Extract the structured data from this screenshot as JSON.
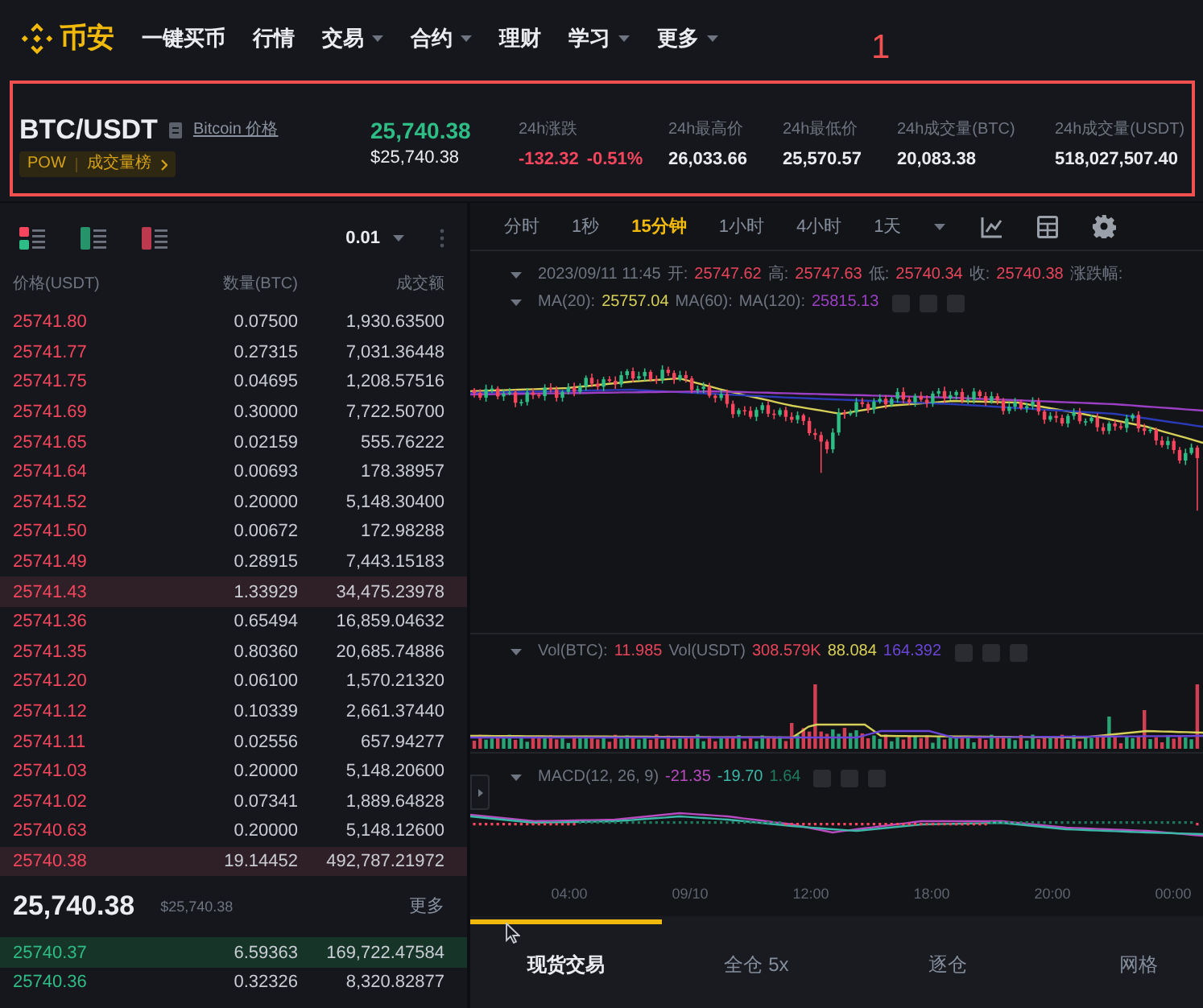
{
  "nav": {
    "logo": "币安",
    "items": [
      {
        "label": "一键买币",
        "has_menu": false
      },
      {
        "label": "行情",
        "has_menu": false
      },
      {
        "label": "交易",
        "has_menu": true
      },
      {
        "label": "合约",
        "has_menu": true
      },
      {
        "label": "理财",
        "has_menu": false
      },
      {
        "label": "学习",
        "has_menu": true
      },
      {
        "label": "更多",
        "has_menu": true
      }
    ]
  },
  "annotation": {
    "label": "1"
  },
  "ticker": {
    "symbol": "BTC/USDT",
    "info_link": "Bitcoin 价格",
    "tags": [
      "POW",
      "成交量榜"
    ],
    "price": "25,740.38",
    "price_usd": "$25,740.38",
    "stats": [
      {
        "label": "24h涨跌",
        "kind": "change",
        "values": [
          "-132.32",
          "-0.51%"
        ]
      },
      {
        "label": "24h最高价",
        "kind": "plain",
        "values": [
          "26,033.66"
        ]
      },
      {
        "label": "24h最低价",
        "kind": "plain",
        "values": [
          "25,570.57"
        ]
      },
      {
        "label": "24h成交量(BTC)",
        "kind": "plain",
        "values": [
          "20,083.38"
        ]
      },
      {
        "label": "24h成交量(USDT)",
        "kind": "plain",
        "values": [
          "518,027,507.40"
        ]
      }
    ]
  },
  "orderbook": {
    "precision": "0.01",
    "columns": [
      "价格(USDT)",
      "数量(BTC)",
      "成交额"
    ],
    "asks": [
      {
        "price": "25741.80",
        "amount": "0.07500",
        "total": "1,930.63500",
        "highlighted": false
      },
      {
        "price": "25741.77",
        "amount": "0.27315",
        "total": "7,031.36448",
        "highlighted": false
      },
      {
        "price": "25741.75",
        "amount": "0.04695",
        "total": "1,208.57516",
        "highlighted": false
      },
      {
        "price": "25741.69",
        "amount": "0.30000",
        "total": "7,722.50700",
        "highlighted": false
      },
      {
        "price": "25741.65",
        "amount": "0.02159",
        "total": "555.76222",
        "highlighted": false
      },
      {
        "price": "25741.64",
        "amount": "0.00693",
        "total": "178.38957",
        "highlighted": false
      },
      {
        "price": "25741.52",
        "amount": "0.20000",
        "total": "5,148.30400",
        "highlighted": false
      },
      {
        "price": "25741.50",
        "amount": "0.00672",
        "total": "172.98288",
        "highlighted": false
      },
      {
        "price": "25741.49",
        "amount": "0.28915",
        "total": "7,443.15183",
        "highlighted": false
      },
      {
        "price": "25741.43",
        "amount": "1.33929",
        "total": "34,475.23978",
        "highlighted": true
      },
      {
        "price": "25741.36",
        "amount": "0.65494",
        "total": "16,859.04632",
        "highlighted": false
      },
      {
        "price": "25741.35",
        "amount": "0.80360",
        "total": "20,685.74886",
        "highlighted": false
      },
      {
        "price": "25741.20",
        "amount": "0.06100",
        "total": "1,570.21320",
        "highlighted": false
      },
      {
        "price": "25741.12",
        "amount": "0.10339",
        "total": "2,661.37440",
        "highlighted": false
      },
      {
        "price": "25741.11",
        "amount": "0.02556",
        "total": "657.94277",
        "highlighted": false
      },
      {
        "price": "25741.03",
        "amount": "0.20000",
        "total": "5,148.20600",
        "highlighted": false
      },
      {
        "price": "25741.02",
        "amount": "0.07341",
        "total": "1,889.64828",
        "highlighted": false
      },
      {
        "price": "25740.63",
        "amount": "0.20000",
        "total": "5,148.12600",
        "highlighted": false
      },
      {
        "price": "25740.38",
        "amount": "19.14452",
        "total": "492,787.21972",
        "highlighted": true
      }
    ],
    "last_price": "25,740.38",
    "last_price_usd": "$25,740.38",
    "more": "更多",
    "bids": [
      {
        "price": "25740.37",
        "amount": "6.59363",
        "total": "169,722.47584",
        "highlighted": true
      },
      {
        "price": "25740.36",
        "amount": "0.32326",
        "total": "8,320.82877",
        "highlighted": false
      }
    ]
  },
  "chart": {
    "intervals": [
      {
        "label": "分时",
        "selected": false
      },
      {
        "label": "1秒",
        "selected": false
      },
      {
        "label": "15分钟",
        "selected": true
      },
      {
        "label": "1小时",
        "selected": false
      },
      {
        "label": "4小时",
        "selected": false
      },
      {
        "label": "1天",
        "selected": false
      }
    ],
    "ohlc": {
      "time": "2023/09/11 11:45",
      "fields": [
        {
          "label": "开:",
          "value": "25747.62"
        },
        {
          "label": "高:",
          "value": "25747.63"
        },
        {
          "label": "低:",
          "value": "25740.34"
        },
        {
          "label": "收:",
          "value": "25740.38"
        },
        {
          "label": "涨跌幅:"
        }
      ]
    },
    "ma": [
      {
        "label": "MA(20):",
        "value": "25757.04",
        "color": "#d6cf58"
      },
      {
        "label": "MA(60):",
        "color": "#2b3bb8"
      },
      {
        "label": "MA(120):",
        "value": "25815.13",
        "color": "#9b3fc4"
      }
    ],
    "volume": {
      "fields": [
        {
          "label": "Vol(BTC):",
          "value": "11.985",
          "color": "#e8445a"
        },
        {
          "label": "Vol(USDT)",
          "value": "308.579K",
          "color": "#e8445a"
        },
        {
          "value": "88.084",
          "color": "#d6cf58"
        },
        {
          "value": "164.392",
          "color": "#6a45d6"
        }
      ]
    },
    "macd": {
      "label": "MACD(12, 26, 9)",
      "values": [
        {
          "value": "-21.35",
          "color": "#b84bbf"
        },
        {
          "value": "-19.70",
          "color": "#3bb8a8"
        },
        {
          "value": "1.64",
          "color": "#1f7a5c"
        }
      ]
    },
    "time_axis": [
      "04:00",
      "09/10",
      "12:00",
      "18:00",
      "20:00",
      "00:00"
    ]
  },
  "trade_tabs": [
    {
      "label": "现货交易",
      "selected": true
    },
    {
      "label": "全仓 5x",
      "selected": false
    },
    {
      "label": "逐仓",
      "selected": false
    },
    {
      "label": "网格",
      "selected": false
    }
  ]
}
